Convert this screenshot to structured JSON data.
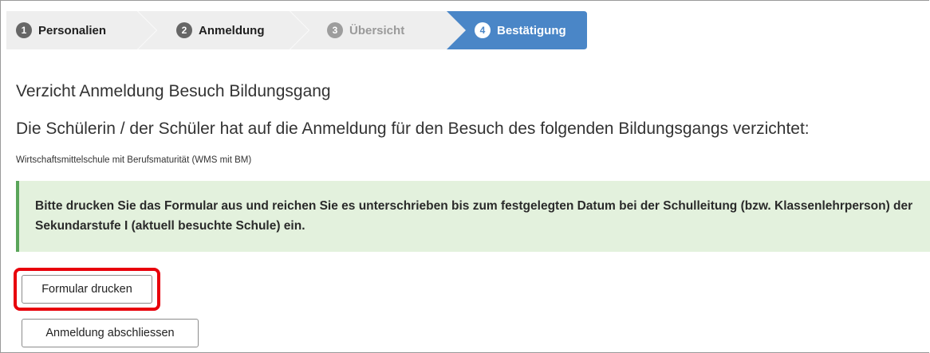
{
  "steps": [
    {
      "number": "1",
      "label": "Personalien",
      "state": "completed"
    },
    {
      "number": "2",
      "label": "Anmeldung",
      "state": "completed"
    },
    {
      "number": "3",
      "label": "Übersicht",
      "state": "disabled"
    },
    {
      "number": "4",
      "label": "Bestätigung",
      "state": "active"
    }
  ],
  "page": {
    "title": "Verzicht Anmeldung Besuch Bildungsgang",
    "subtitle": "Die Schülerin / der Schüler hat auf die Anmeldung für den Besuch des folgenden Bildungsgangs verzichtet:",
    "program": "Wirtschaftsmittelschule mit Berufsmaturität (WMS mit BM)"
  },
  "alert": {
    "text": "Bitte drucken Sie das Formular aus und reichen Sie es unterschrieben bis zum festgelegten Datum bei der Schulleitung (bzw. Klassenlehrperson) der Sekundarstufe I (aktuell besuchte Schule) ein."
  },
  "buttons": {
    "print_label": "Formular drucken",
    "finish_label": "Anmeldung abschliessen"
  },
  "colors": {
    "active_step": "#4a86c7",
    "inactive_step": "#eeeeee",
    "alert_background": "#e3f1dd",
    "alert_border": "#5aa55a",
    "highlight": "#e8000b"
  }
}
